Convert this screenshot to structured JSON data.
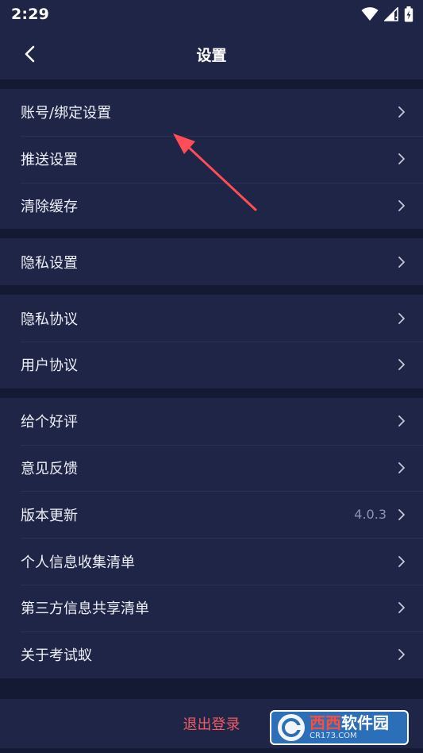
{
  "status_bar": {
    "time": "2:29"
  },
  "header": {
    "title": "设置"
  },
  "groups": [
    {
      "items": [
        {
          "label": "账号/绑定设置"
        },
        {
          "label": "推送设置"
        },
        {
          "label": "清除缓存"
        }
      ]
    },
    {
      "items": [
        {
          "label": "隐私设置"
        }
      ]
    },
    {
      "items": [
        {
          "label": "隐私协议"
        },
        {
          "label": "用户协议"
        }
      ]
    },
    {
      "items": [
        {
          "label": "给个好评"
        },
        {
          "label": "意见反馈"
        },
        {
          "label": "版本更新",
          "value": "4.0.3"
        },
        {
          "label": "个人信息收集清单"
        },
        {
          "label": "第三方信息共享清单"
        },
        {
          "label": "关于考试蚁"
        }
      ]
    }
  ],
  "logout": {
    "label": "退出登录"
  },
  "watermark": {
    "main_a": "西西",
    "main_b": "软件园",
    "sub": "CR173.COM"
  },
  "colors": {
    "background": "#141934",
    "panel": "#1f2547",
    "logout_text": "#f05b64",
    "annotation_arrow": "#ff4d57"
  },
  "icons": {
    "back": "chevron-left-icon",
    "row": "chevron-right-icon",
    "wifi": "wifi-icon",
    "signal": "signal-icon",
    "battery": "battery-icon"
  }
}
